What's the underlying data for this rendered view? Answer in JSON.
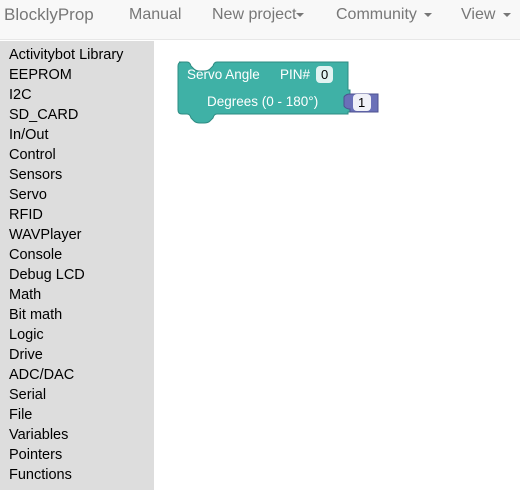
{
  "navbar": {
    "brand": "BlocklyProp",
    "links": [
      {
        "label": "Manual",
        "has_caret": false
      },
      {
        "label": "New project",
        "has_caret": true
      },
      {
        "label": "Community",
        "has_caret": true
      },
      {
        "label": "View",
        "has_caret": true
      }
    ]
  },
  "toolbox": {
    "categories": [
      "Activitybot Library",
      "EEPROM",
      "I2C",
      "SD_CARD",
      "In/Out",
      "Control",
      "Sensors",
      "Servo",
      "RFID",
      "WAVPlayer",
      "Console",
      "Debug LCD",
      "Math",
      "Bit math",
      "Logic",
      "Drive",
      "ADC/DAC",
      "Serial",
      "File",
      "Variables",
      "Pointers",
      "Functions"
    ]
  },
  "workspace": {
    "servo_block": {
      "title": "Servo Angle",
      "pin_label": "PIN#",
      "pin_value": "0",
      "degrees_label": "Degrees (0 - 180°)",
      "color": "#3fb1a6"
    },
    "number_block": {
      "value": "1",
      "color": "#6a70b8"
    }
  }
}
